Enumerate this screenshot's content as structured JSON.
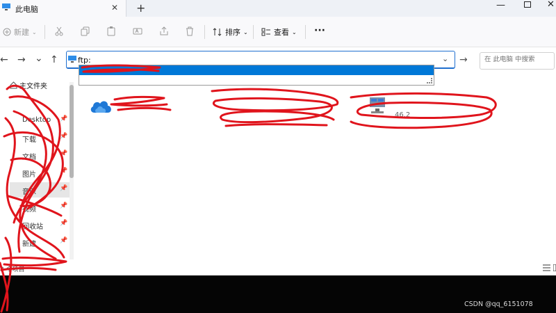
{
  "window": {
    "tab_title": "此电脑",
    "close_glyph": "✕",
    "add_glyph": "+",
    "min_glyph": "—",
    "wclose_glyph": "✕"
  },
  "toolbar": {
    "new_label": "新建",
    "sort_label": "排序",
    "view_label": "查看",
    "more_label": "···",
    "icons": [
      "add-icon",
      "cut-icon",
      "copy-icon",
      "paste-icon",
      "rename-icon",
      "share-icon",
      "delete-icon"
    ]
  },
  "nav": {
    "back": "←",
    "forward": "→",
    "recent": "⌄",
    "up": "↑",
    "go": "→"
  },
  "address": {
    "value": "ftp:"
  },
  "search": {
    "placeholder": "在 此电脑 中搜索"
  },
  "sidebar": {
    "home_label": "主文件夹",
    "items": [
      {
        "label": "Desktop",
        "pinned": true
      },
      {
        "label": "下载",
        "pinned": true
      },
      {
        "label": "文档",
        "pinned": true
      },
      {
        "label": "图片",
        "pinned": true
      },
      {
        "label": "音乐",
        "pinned": true,
        "selected": true
      },
      {
        "label": "视频",
        "pinned": true
      },
      {
        "label": "回收站",
        "pinned": true
      },
      {
        "label": "新建",
        "pinned": true
      }
    ]
  },
  "content": {
    "network_text": "46.2"
  },
  "status": {
    "count_text": "3 个项目"
  },
  "footer": {
    "watermark": "CSDN @qq_6151078"
  },
  "colors": {
    "accent": "#0078d7",
    "scribble": "#e0141c"
  }
}
